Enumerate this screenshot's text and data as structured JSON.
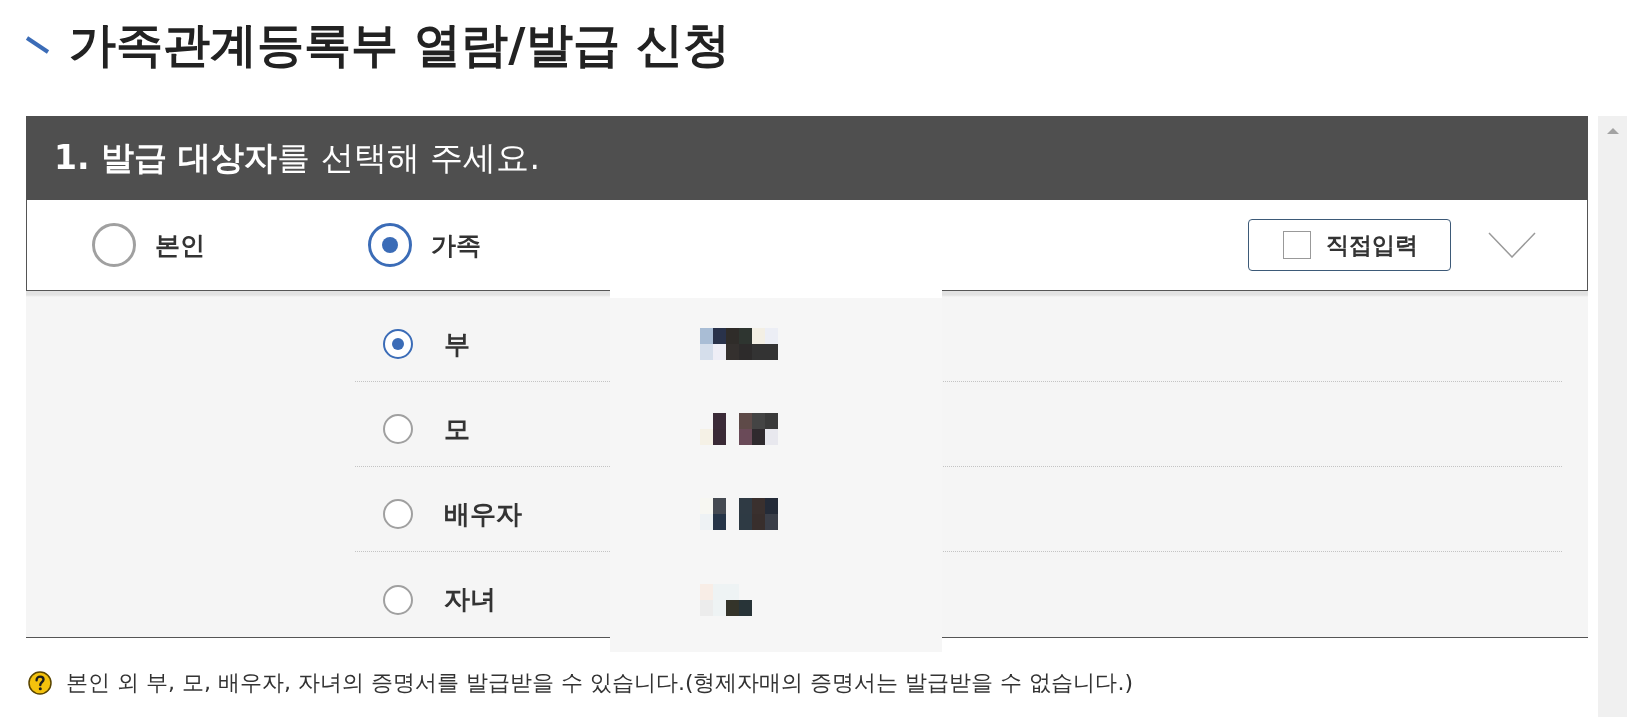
{
  "page_title": "가족관계등록부 열람/발급 신청",
  "section": {
    "heading": "**1. 발급 대상자**를 선택해 주세요.",
    "target_options": [
      {
        "label": "본인",
        "selected": false
      },
      {
        "label": "가족",
        "selected": true
      }
    ],
    "direct_input_button": {
      "label": "직접입력",
      "checked": false
    },
    "family_members": [
      {
        "relation": "부",
        "selected": true
      },
      {
        "relation": "모",
        "selected": false
      },
      {
        "relation": "배우자",
        "selected": false
      },
      {
        "relation": "자녀",
        "selected": false
      }
    ]
  },
  "notice": {
    "text": "본인 외 부, 모, 배우자, 자녀의 증명서를 발급받을 수 있습니다.(형제자매의 증명서는 발급받을 수 없습니다.)"
  }
}
